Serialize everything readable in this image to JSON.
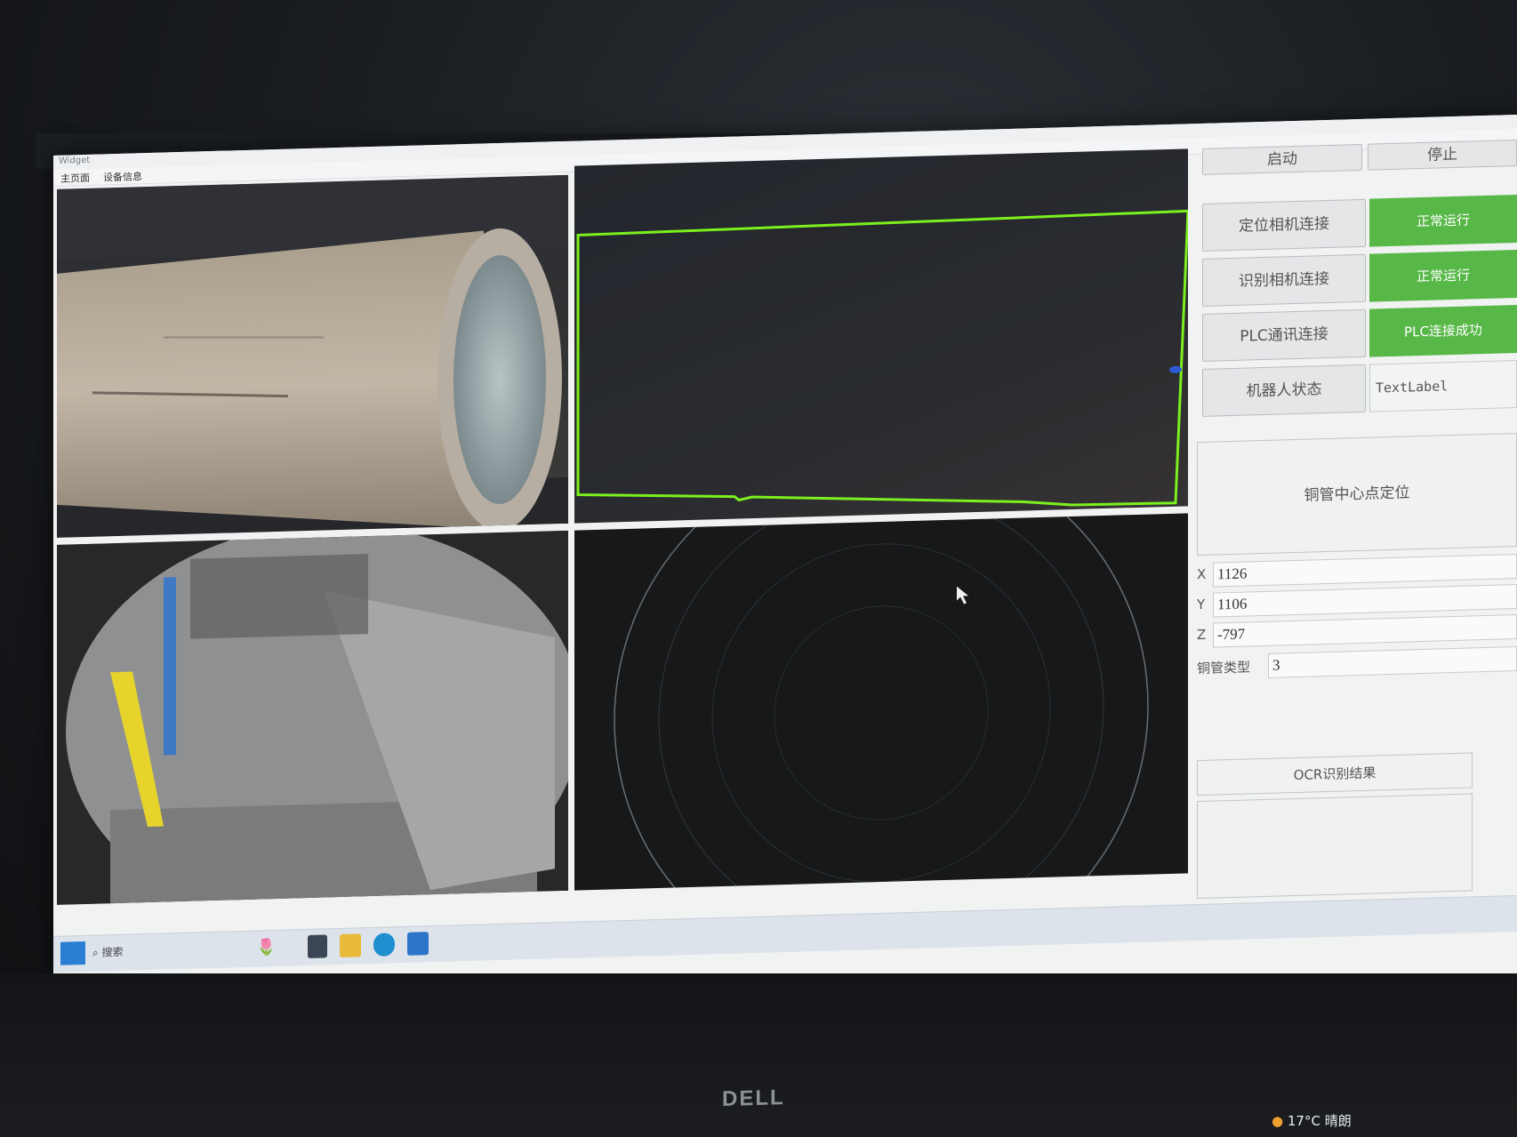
{
  "window": {
    "title": "Widget"
  },
  "menu": {
    "items": [
      "主页面",
      "设备信息"
    ]
  },
  "controls": {
    "start_label": "启动",
    "stop_label": "停止"
  },
  "status_rows": [
    {
      "label": "定位相机连接",
      "status": "正常运行"
    },
    {
      "label": "识别相机连接",
      "status": "正常运行"
    },
    {
      "label": "PLC通讯连接",
      "status": "PLC连接成功"
    }
  ],
  "robot": {
    "label": "机器人状态",
    "value": "TextLabel"
  },
  "locate": {
    "button_label": "铜管中心点定位"
  },
  "coords": {
    "x_label": "X",
    "x_value": "1126",
    "y_label": "Y",
    "y_value": "1106",
    "z_label": "Z",
    "z_value": "-797",
    "type_label": "铜管类型",
    "type_value": "3"
  },
  "ocr": {
    "button_label": "OCR识别结果",
    "result": ""
  },
  "taskbar": {
    "search_label": "搜索",
    "weather": "17°C",
    "weather_desc": "晴朗"
  },
  "monitor": {
    "brand": "DELL"
  },
  "colors": {
    "status_green": "#57b847",
    "detect_green": "#7cf01e",
    "detect_red": "#e0332b"
  }
}
